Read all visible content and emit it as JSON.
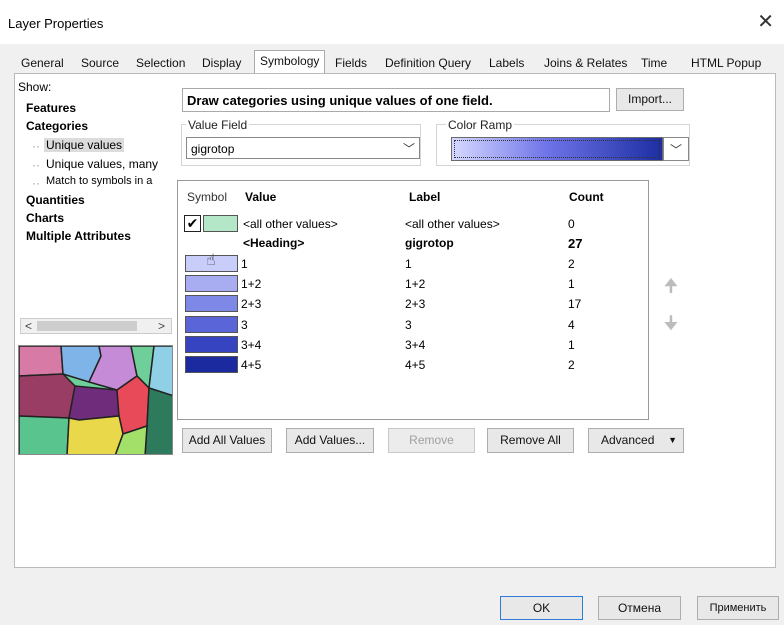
{
  "window": {
    "title": "Layer Properties",
    "close": "✕"
  },
  "tabs": [
    "General",
    "Source",
    "Selection",
    "Display",
    "Symbology",
    "Fields",
    "Definition Query",
    "Labels",
    "Joins & Relates",
    "Time",
    "HTML Popup"
  ],
  "active_tab": "Symbology",
  "show": {
    "label": "Show:",
    "items": [
      "Features",
      "Categories",
      "Unique values",
      "Unique values, many",
      "Match to symbols in a",
      "Quantities",
      "Charts",
      "Multiple Attributes"
    ],
    "selected": "Unique values"
  },
  "description": "Draw categories using unique values of one field.",
  "import_label": "Import...",
  "value_field": {
    "label": "Value Field",
    "value": "gigrotop"
  },
  "color_ramp": {
    "label": "Color Ramp",
    "from": "#d6d9ff",
    "to": "#1c2ea3"
  },
  "table": {
    "headers": {
      "symbol": "Symbol",
      "value": "Value",
      "label": "Label",
      "count": "Count"
    },
    "rows": [
      {
        "value": "<all other values>",
        "label": "<all other values>",
        "count": "0",
        "color": "#b4e6c8"
      },
      {
        "value": "<Heading>",
        "label": "gigrotop",
        "count": "27",
        "heading": true
      },
      {
        "value": "1",
        "label": "1",
        "count": "2",
        "color": "#c9cdfa"
      },
      {
        "value": "1+2",
        "label": "1+2",
        "count": "1",
        "color": "#a7adf0"
      },
      {
        "value": "2+3",
        "label": "2+3",
        "count": "17",
        "color": "#7e88e6"
      },
      {
        "value": "3",
        "label": "3",
        "count": "4",
        "color": "#5a66d8"
      },
      {
        "value": "3+4",
        "label": "3+4",
        "count": "1",
        "color": "#3744c2"
      },
      {
        "value": "4+5",
        "label": "4+5",
        "count": "2",
        "color": "#1c2aa0"
      }
    ]
  },
  "buttons": {
    "add_all": "Add All Values",
    "add_values": "Add Values...",
    "remove": "Remove",
    "remove_all": "Remove All",
    "advanced": "Advanced",
    "ok": "OK",
    "cancel": "Отмена",
    "apply": "Применить"
  },
  "icons": {
    "move_up": "up-arrow-icon",
    "move_down": "down-arrow-icon",
    "dropdown": "chevron-down-icon"
  }
}
